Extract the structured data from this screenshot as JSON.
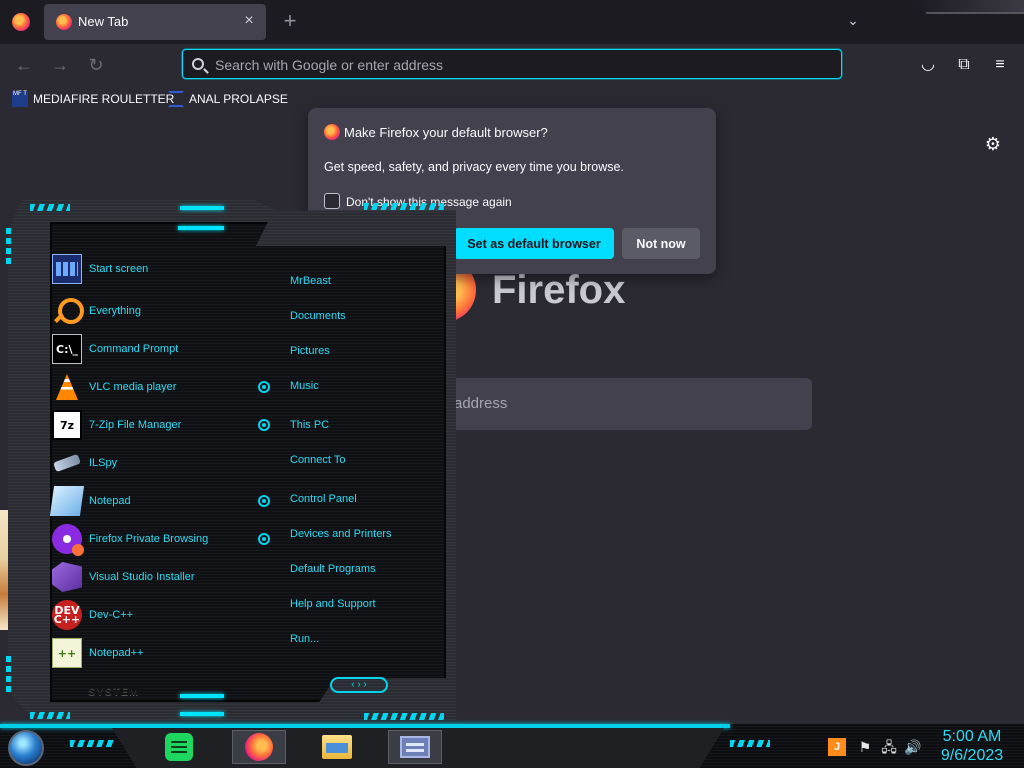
{
  "browser": {
    "tab": {
      "title": "New Tab",
      "close_glyph": "×"
    },
    "new_tab_glyph": "+",
    "tabs_menu_glyph": "⌄",
    "nav": {
      "back_glyph": "←",
      "forward_glyph": "→",
      "reload_glyph": "↻"
    },
    "urlbar": {
      "placeholder": "Search with Google or enter address",
      "value": ""
    },
    "toolbar": {
      "pocket_glyph": "◡",
      "extensions_glyph": "⧉",
      "menu_glyph": "≡"
    },
    "bookmarks": [
      {
        "label": "MEDIAFIRE ROULETTER",
        "icon_text": "MF T"
      },
      {
        "label": "ANAL PROLAPSE"
      }
    ],
    "accent": "#00ddff"
  },
  "newtab": {
    "gear_glyph": "⚙",
    "wordmark": "Firefox",
    "search_placeholder": "address"
  },
  "popup": {
    "title": "Make Firefox your default browser?",
    "body": "Get speed, safety, and privacy every time you browse.",
    "checkbox_label": "Don't show this message again",
    "primary_button": "Set as default browser",
    "secondary_button": "Not now"
  },
  "start_menu": {
    "programs": [
      {
        "label": "Start screen",
        "icon": "start-screen-icon",
        "icon_text": ""
      },
      {
        "label": "Everything",
        "icon": "magnifier-icon",
        "icon_text": ""
      },
      {
        "label": "Command Prompt",
        "icon": "command-prompt-icon",
        "icon_text": "C:\\_"
      },
      {
        "label": "VLC media player",
        "icon": "vlc-cone-icon",
        "icon_text": ""
      },
      {
        "label": "7-Zip File Manager",
        "icon": "7zip-icon",
        "icon_text": "7z"
      },
      {
        "label": "ILSpy",
        "icon": "ilspy-icon",
        "icon_text": ""
      },
      {
        "label": "Notepad",
        "icon": "notepad-icon",
        "icon_text": ""
      },
      {
        "label": "Firefox Private Browsing",
        "icon": "firefox-private-icon",
        "icon_text": ""
      },
      {
        "label": "Visual Studio Installer",
        "icon": "visual-studio-icon",
        "icon_text": ""
      },
      {
        "label": "Dev-C++",
        "icon": "dev-cpp-icon",
        "icon_text": "DEV C++"
      },
      {
        "label": "Notepad++",
        "icon": "notepad-plus-plus-icon",
        "icon_text": "++"
      }
    ],
    "places": [
      "MrBeast",
      "Documents",
      "Pictures",
      "Music",
      "This PC",
      "Connect To",
      "Control Panel",
      "Devices and Printers",
      "Default Programs",
      "Help and Support",
      "Run..."
    ],
    "system_label": "SYSTEM",
    "pager_glyph": "‹ › ›",
    "accent": "#29dcf5"
  },
  "taskbar": {
    "apps": [
      "spotify-icon",
      "firefox-icon",
      "file-explorer-icon",
      "remote-desktop-icon"
    ],
    "tray": {
      "java_text": "J",
      "flag_glyph": "⚑",
      "network_glyph": "🖧",
      "volume_glyph": "🔊"
    },
    "clock": {
      "time": "5:00 AM",
      "date": "9/6/2023"
    }
  }
}
